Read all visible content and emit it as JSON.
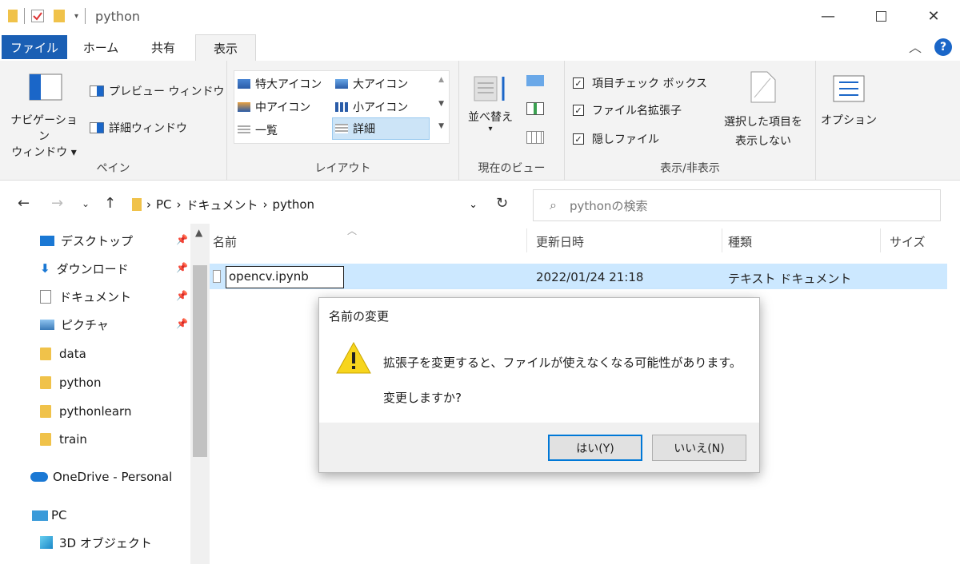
{
  "window": {
    "title": "python",
    "minimize_icon": "minimize-icon",
    "maximize_icon": "maximize-icon",
    "close_icon": "close-icon"
  },
  "ribbon_tabs": [
    {
      "label": "ファイル"
    },
    {
      "label": "ホーム"
    },
    {
      "label": "共有"
    },
    {
      "label": "表示"
    }
  ],
  "ribbon": {
    "pane": {
      "nav_pane_line1": "ナビゲーション",
      "nav_pane_line2": "ウィンドウ",
      "preview": "プレビュー ウィンドウ",
      "details": "詳細ウィンドウ",
      "label": "ペイン"
    },
    "layout": {
      "items": [
        "特大アイコン",
        "大アイコン",
        "中アイコン",
        "小アイコン",
        "一覧",
        "詳細"
      ],
      "label": "レイアウト"
    },
    "current_view": {
      "sort": "並べ替え",
      "label": "現在のビュー"
    },
    "show_hide": {
      "item_checkbox": "項目チェック ボックス",
      "extensions": "ファイル名拡張子",
      "hidden": "隠しファイル",
      "hide_selected_line1": "選択した項目を",
      "hide_selected_line2": "表示しない",
      "label": "表示/非表示"
    },
    "options": "オプション"
  },
  "address": {
    "crumbs": [
      "PC",
      "ドキュメント",
      "python"
    ],
    "search_placeholder": "pythonの検索"
  },
  "sidebar": {
    "items": [
      {
        "label": "デスクトップ"
      },
      {
        "label": "ダウンロード"
      },
      {
        "label": "ドキュメント"
      },
      {
        "label": "ピクチャ"
      },
      {
        "label": "data"
      },
      {
        "label": "python"
      },
      {
        "label": "pythonlearn"
      },
      {
        "label": "train"
      },
      {
        "label": "OneDrive - Personal"
      },
      {
        "label": "PC"
      },
      {
        "label": "3D オブジェクト"
      }
    ]
  },
  "filelist": {
    "headers": {
      "name": "名前",
      "date": "更新日時",
      "type": "種類",
      "size": "サイズ"
    },
    "rows": [
      {
        "name": "opencv.ipynb",
        "date": "2022/01/24 21:18",
        "type": "テキスト ドキュメント"
      }
    ]
  },
  "dialog": {
    "title": "名前の変更",
    "message": "拡張子を変更すると、ファイルが使えなくなる可能性があります。",
    "question": "変更しますか?",
    "yes": "はい(Y)",
    "no": "いいえ(N)"
  },
  "colors": {
    "accent": "#1a5fb4",
    "selection": "#cce8ff",
    "folder": "#f0c24a",
    "warning": "#f7d51d"
  }
}
